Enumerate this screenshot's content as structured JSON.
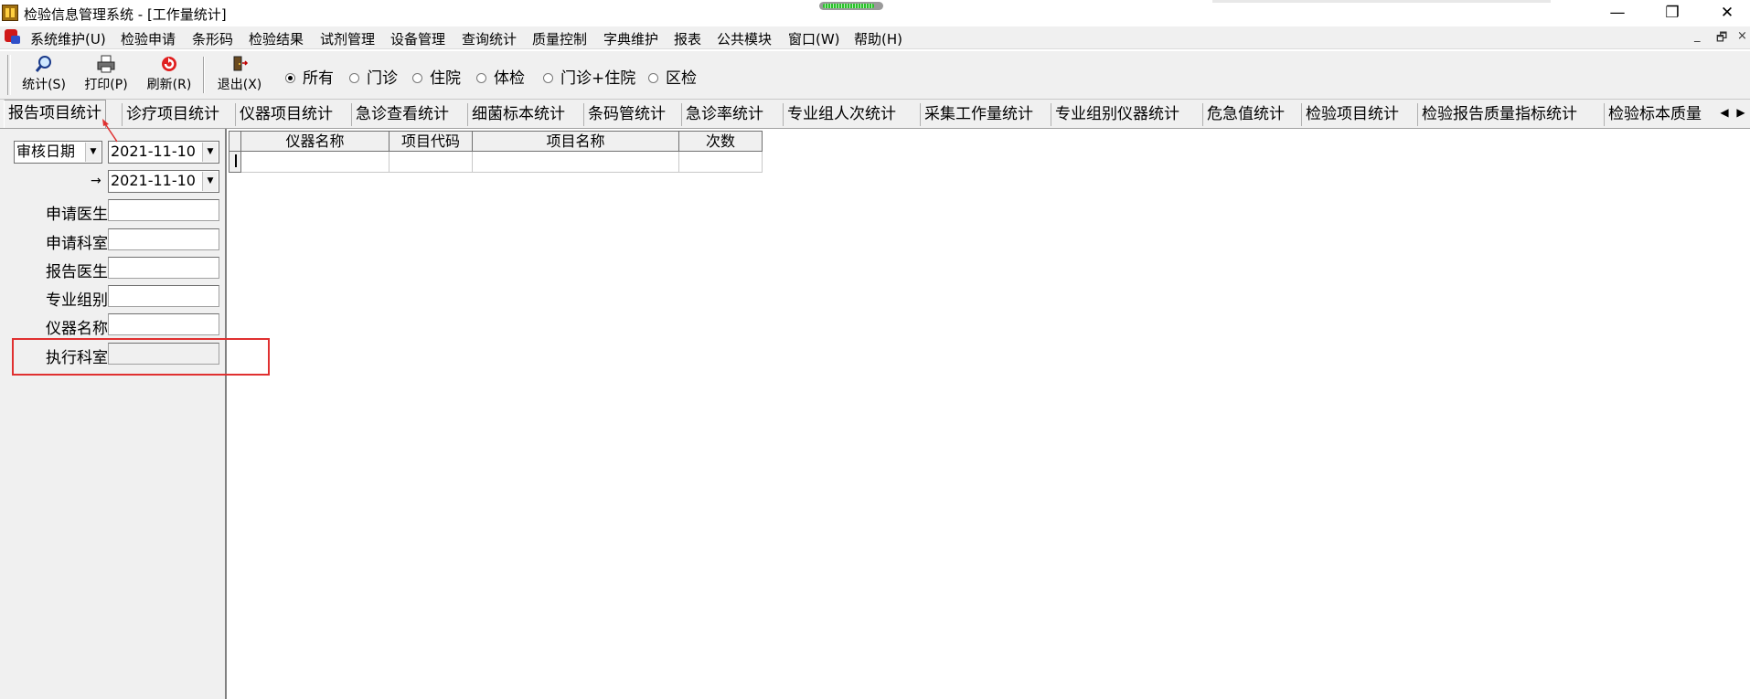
{
  "window": {
    "title": "检验信息管理系统 - [工作量统计]",
    "minimize": "—",
    "restore": "❐",
    "close": "✕"
  },
  "menu": {
    "items": [
      "系统维护(U)",
      "检验申请",
      "条形码",
      "检验结果",
      "试剂管理",
      "设备管理",
      "查询统计",
      "质量控制",
      "字典维护",
      "报表",
      "公共模块",
      "窗口(W)",
      "帮助(H)"
    ],
    "mdi_min": "_",
    "mdi_restore": "🗗",
    "mdi_close": "×"
  },
  "toolbar": {
    "stats_label": "统计(S)",
    "print_label": "打印(P)",
    "refresh_label": "刷新(R)",
    "exit_label": "退出(X)",
    "radios": [
      "所有",
      "门诊",
      "住院",
      "体检",
      "门诊+住院",
      "区检"
    ],
    "selected_radio": "所有"
  },
  "tabs": [
    "报告项目统计",
    "诊疗项目统计",
    "仪器项目统计",
    "急诊查看统计",
    "细菌标本统计",
    "条码管统计",
    "急诊率统计",
    "专业组人次统计",
    "采集工作量统计",
    "专业组别仪器统计",
    "危急值统计",
    "检验项目统计",
    "检验报告质量指标统计",
    "检验标本质量"
  ],
  "active_tab": "报告项目统计",
  "filters": {
    "date_type": "审核日期",
    "date_from": "2021-11-10",
    "date_to": "2021-11-10",
    "date_to_arrow": "→",
    "fields": [
      {
        "label": "申请医生",
        "value": ""
      },
      {
        "label": "申请科室",
        "value": ""
      },
      {
        "label": "报告医生",
        "value": ""
      },
      {
        "label": "专业组别",
        "value": ""
      },
      {
        "label": "仪器名称",
        "value": ""
      },
      {
        "label": "执行科室",
        "value": ""
      }
    ]
  },
  "grid": {
    "columns": [
      "仪器名称",
      "项目代码",
      "项目名称",
      "次数"
    ],
    "rows": [
      [
        "",
        "",
        "",
        ""
      ]
    ]
  },
  "colors": {
    "highlight": "#e03030",
    "chrome": "#f0f0f0"
  }
}
